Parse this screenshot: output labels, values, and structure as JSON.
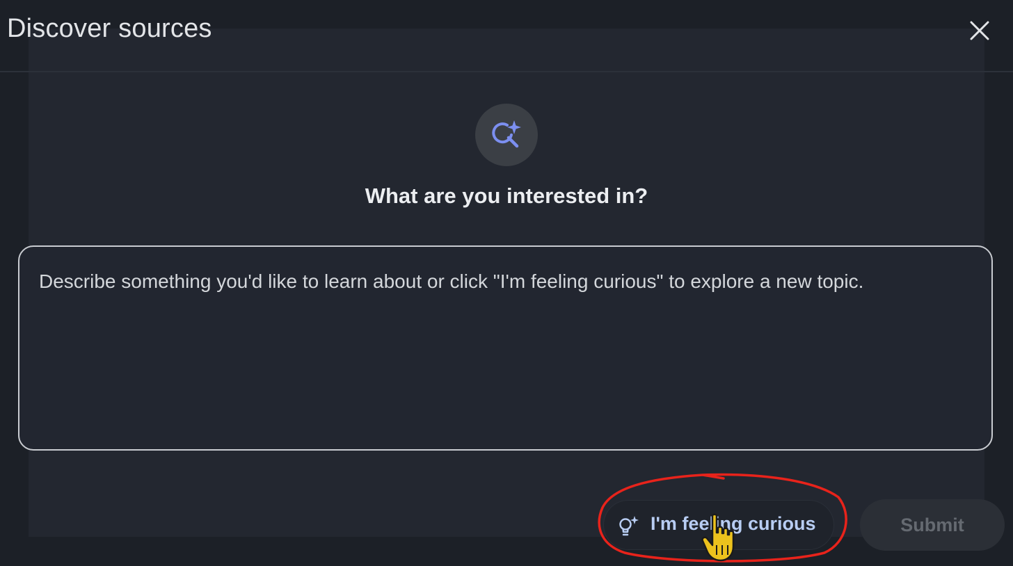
{
  "dialog": {
    "title": "Discover sources",
    "close_icon": "close-icon"
  },
  "hero": {
    "icon": "search-sparkle-icon",
    "question": "What are you interested in?"
  },
  "prompt": {
    "value": "",
    "placeholder": "Describe something you'd like to learn about or click \"I'm feeling curious\" to explore a new topic."
  },
  "actions": {
    "curious_label": "I'm feeling curious",
    "curious_icon": "lightbulb-sparkle-icon",
    "submit_label": "Submit"
  },
  "colors": {
    "background": "#1c2027",
    "panel": "#232730",
    "accent_icon": "#7c8ff0",
    "curious_text": "#b8cdf3",
    "submit_disabled_text": "#656a71",
    "annotation_red": "#e8231b"
  }
}
